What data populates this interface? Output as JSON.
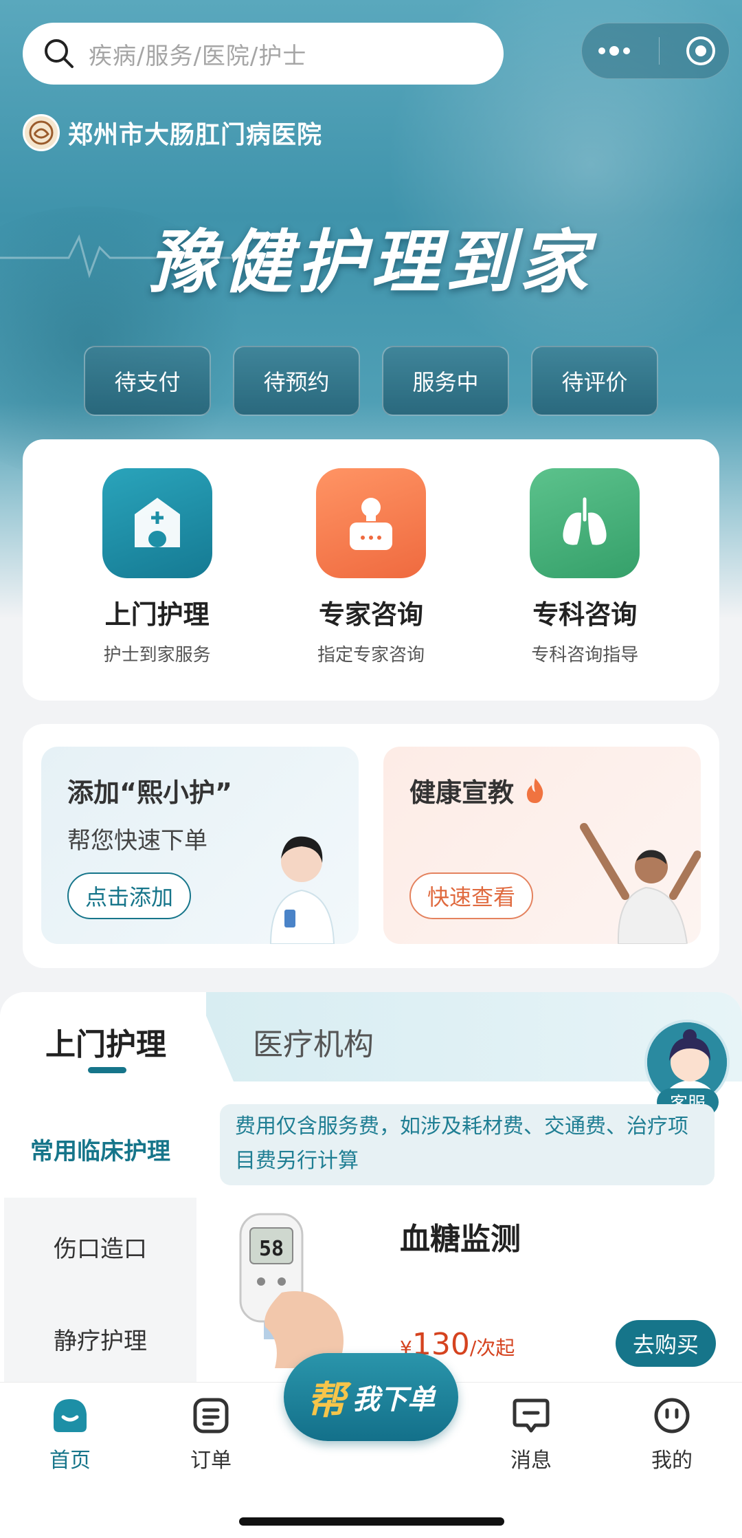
{
  "search": {
    "placeholder": "疾病/服务/医院/护士"
  },
  "hospital": {
    "name": "郑州市大肠肛门病医院"
  },
  "hero": {
    "slogan": "豫健护理到家"
  },
  "order_status": [
    "待支付",
    "待预约",
    "服务中",
    "待评价"
  ],
  "services": [
    {
      "title": "上门护理",
      "subtitle": "护士到家服务",
      "icon": "house-plus-icon",
      "color": "#1d8fa6"
    },
    {
      "title": "专家咨询",
      "subtitle": "指定专家咨询",
      "icon": "doctor-icon",
      "color": "#f27b4b"
    },
    {
      "title": "专科咨询",
      "subtitle": "专科咨询指导",
      "icon": "lungs-icon",
      "color": "#44b07a"
    }
  ],
  "promo": {
    "add_helper": {
      "title": "添加“熙小护”",
      "subtitle": "帮您快速下单",
      "button": "点击添加"
    },
    "health_edu": {
      "title": "健康宣教",
      "button": "快速查看"
    }
  },
  "tabs": {
    "active": "上门护理",
    "inactive": "医疗机构"
  },
  "customer_service": {
    "label": "客服"
  },
  "categories": [
    "常用临床护理",
    "伤口造口",
    "静疗护理"
  ],
  "notice": "费用仅含服务费，如涉及耗材费、交通费、治疗项目费另行计算",
  "product": {
    "title": "血糖监测",
    "currency": "¥",
    "price": "130",
    "unit": "/次起",
    "buy_label": "去购买",
    "meter_reading": "58"
  },
  "fab": {
    "big": "帮",
    "text": "我下单"
  },
  "nav": [
    {
      "label": "首页",
      "icon": "home-icon"
    },
    {
      "label": "订单",
      "icon": "order-icon"
    },
    {
      "label": "消息",
      "icon": "message-icon"
    },
    {
      "label": "我的",
      "icon": "profile-icon"
    }
  ],
  "colors": {
    "primary": "#16758a",
    "price": "#d5431f",
    "hero": "#4a9bb3"
  }
}
